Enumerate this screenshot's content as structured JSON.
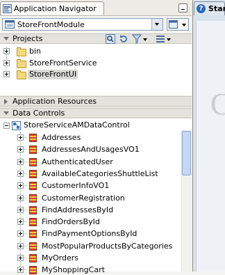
{
  "window": {
    "title": "Application Navigator",
    "editor_tab_label": "Star",
    "editor_help_glyph": "?"
  },
  "navigator": {
    "application_combo_value": "StoreFrontModule"
  },
  "projects": {
    "header": "Projects",
    "items": [
      {
        "label": "bin",
        "expanded": false,
        "selected": false
      },
      {
        "label": "StoreFrontService",
        "expanded": false,
        "selected": false
      },
      {
        "label": "StoreFrontUI",
        "expanded": false,
        "selected": true
      }
    ]
  },
  "application_resources": {
    "header": "Application Resources",
    "expanded": false
  },
  "data_controls": {
    "header": "Data Controls",
    "root": "StoreServiceAMDataControl",
    "items": [
      "Addresses",
      "AddressesAndUsagesVO1",
      "AuthenticatedUser",
      "AvailableCategoriesShuttleList",
      "CustomerInfoVO1",
      "CustomerRegistration",
      "FindAddressesById",
      "FindOrdersById",
      "FindPaymentOptionsById",
      "MostPopularProductsByCategories",
      "MyOrders",
      "MyShoppingCart"
    ]
  },
  "editor": {
    "partial_glyph": "C"
  },
  "colors": {
    "selection": "#d9d9d6",
    "accent": "#2c68b9"
  }
}
